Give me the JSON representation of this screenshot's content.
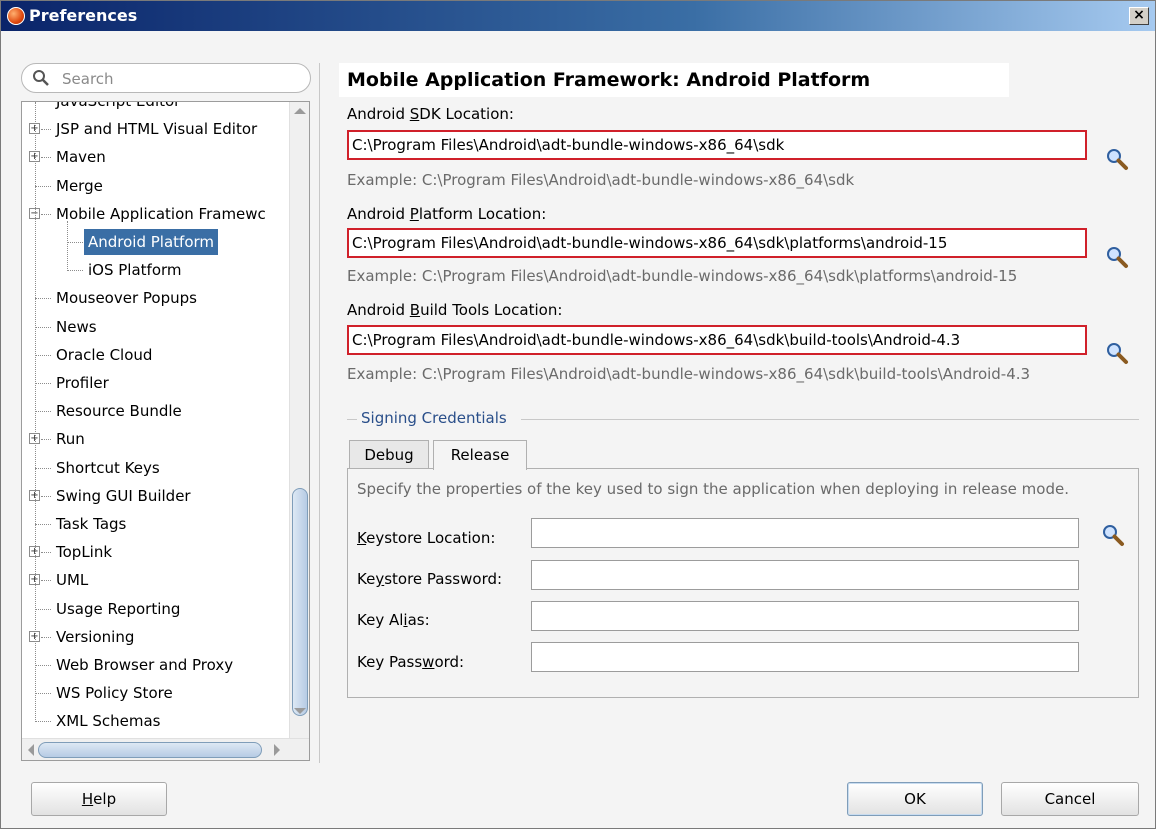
{
  "window": {
    "title": "Preferences",
    "close_label": "×"
  },
  "search": {
    "placeholder": "Search",
    "value": ""
  },
  "tree": {
    "items": [
      {
        "label": "JavaScript Editor",
        "expandable": false,
        "level": 0
      },
      {
        "label": "JSP and HTML Visual Editor",
        "expandable": true,
        "level": 0
      },
      {
        "label": "Maven",
        "expandable": true,
        "level": 0
      },
      {
        "label": "Merge",
        "expandable": false,
        "level": 0
      },
      {
        "label": "Mobile Application Framewc",
        "expandable": true,
        "expanded": true,
        "level": 0
      },
      {
        "label": "Android Platform",
        "expandable": false,
        "level": 1,
        "selected": true
      },
      {
        "label": "iOS Platform",
        "expandable": false,
        "level": 1
      },
      {
        "label": "Mouseover Popups",
        "expandable": false,
        "level": 0
      },
      {
        "label": "News",
        "expandable": false,
        "level": 0
      },
      {
        "label": "Oracle Cloud",
        "expandable": false,
        "level": 0
      },
      {
        "label": "Profiler",
        "expandable": false,
        "level": 0
      },
      {
        "label": "Resource Bundle",
        "expandable": false,
        "level": 0
      },
      {
        "label": "Run",
        "expandable": true,
        "level": 0
      },
      {
        "label": "Shortcut Keys",
        "expandable": false,
        "level": 0
      },
      {
        "label": "Swing GUI Builder",
        "expandable": true,
        "level": 0
      },
      {
        "label": "Task Tags",
        "expandable": false,
        "level": 0
      },
      {
        "label": "TopLink",
        "expandable": true,
        "level": 0
      },
      {
        "label": "UML",
        "expandable": true,
        "level": 0
      },
      {
        "label": "Usage Reporting",
        "expandable": false,
        "level": 0
      },
      {
        "label": "Versioning",
        "expandable": true,
        "level": 0
      },
      {
        "label": "Web Browser and Proxy",
        "expandable": false,
        "level": 0
      },
      {
        "label": "WS Policy Store",
        "expandable": false,
        "level": 0
      },
      {
        "label": "XML Schemas",
        "expandable": false,
        "level": 0
      }
    ]
  },
  "main": {
    "title": "Mobile Application Framework: Android Platform",
    "sdk": {
      "label_pre": "Android ",
      "label_mnemonic": "S",
      "label_post": "DK Location:",
      "value": "C:\\Program Files\\Android\\adt-bundle-windows-x86_64\\sdk",
      "example": "Example: C:\\Program Files\\Android\\adt-bundle-windows-x86_64\\sdk"
    },
    "platform": {
      "label_pre": "Android ",
      "label_mnemonic": "P",
      "label_post": "latform Location:",
      "value": "C:\\Program Files\\Android\\adt-bundle-windows-x86_64\\sdk\\platforms\\android-15",
      "example": "Example: C:\\Program Files\\Android\\adt-bundle-windows-x86_64\\sdk\\platforms\\android-15"
    },
    "build_tools": {
      "label_pre": "Android ",
      "label_mnemonic": "B",
      "label_post": "uild Tools Location:",
      "value": "C:\\Program Files\\Android\\adt-bundle-windows-x86_64\\sdk\\build-tools\\Android-4.3",
      "example": "Example: C:\\Program Files\\Android\\adt-bundle-windows-x86_64\\sdk\\build-tools\\Android-4.3"
    },
    "signing": {
      "title": "Signing Credentials",
      "tabs": [
        {
          "label": "Debug"
        },
        {
          "label": "Release",
          "active": true
        }
      ],
      "description": "Specify the properties of the key used to sign the application when deploying in release mode.",
      "keystore_location": {
        "pre": "",
        "mn": "K",
        "post": "eystore Location:",
        "value": ""
      },
      "keystore_password": {
        "pre": "Ke",
        "mn": "y",
        "post": "store Password:",
        "value": ""
      },
      "key_alias": {
        "pre": "Key Al",
        "mn": "i",
        "post": "as:",
        "value": ""
      },
      "key_password": {
        "pre": "Key Pass",
        "mn": "w",
        "post": "ord:",
        "value": ""
      }
    }
  },
  "buttons": {
    "help_pre": "",
    "help_mn": "H",
    "help_post": "elp",
    "ok": "OK",
    "cancel": "Cancel"
  },
  "colors": {
    "title_bar": "#0a246a",
    "selection": "#3a6ea5",
    "required_border": "#d0202a"
  }
}
